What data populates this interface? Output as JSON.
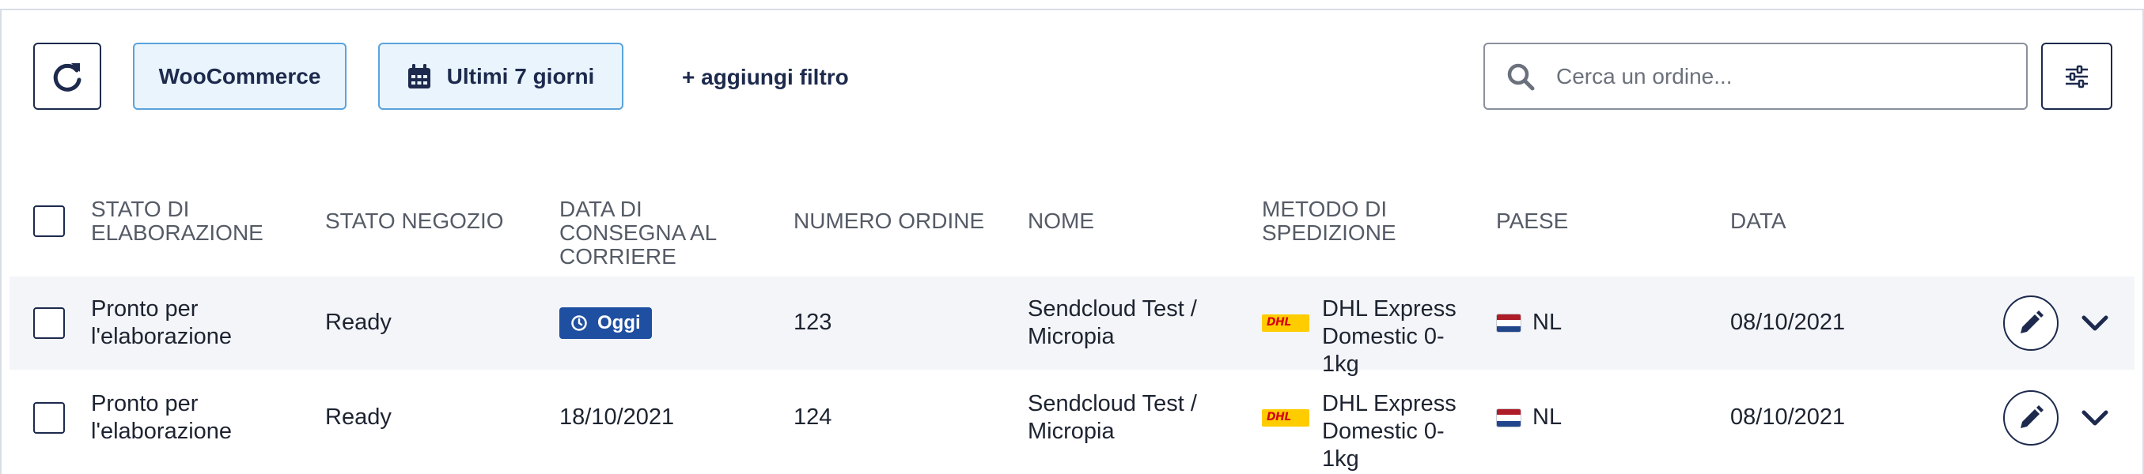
{
  "toolbar": {
    "woocommerce_label": "WooCommerce",
    "date_filter_label": "Ultimi 7 giorni",
    "add_filter_label": "+ aggiungi filtro",
    "search_placeholder": "Cerca un ordine..."
  },
  "table": {
    "headers": {
      "processing_status": "STATO DI ELABORAZIONE",
      "shop_status": "STATO NEGOZIO",
      "carrier_delivery_date": "DATA DI CONSEGNA AL CORRIERE",
      "order_number": "NUMERO ORDINE",
      "name": "NOME",
      "shipping_method": "METODO DI SPEDIZIONE",
      "country": "PAESE",
      "date": "DATA"
    },
    "rows": [
      {
        "processing_status": "Pronto per l'elaborazione",
        "shop_status": "Ready",
        "carrier_delivery_date": "Oggi",
        "carrier_delivery_is_badge": true,
        "order_number": "123",
        "name": "Sendcloud Test / Micropia",
        "carrier_logo_text": "DHL",
        "shipping_method": "DHL Express Domestic 0-1kg",
        "country": "NL",
        "date": "08/10/2021"
      },
      {
        "processing_status": "Pronto per l'elaborazione",
        "shop_status": "Ready",
        "carrier_delivery_date": "18/10/2021",
        "carrier_delivery_is_badge": false,
        "order_number": "124",
        "name": "Sendcloud Test / Micropia",
        "carrier_logo_text": "DHL",
        "shipping_method": "DHL Express Domestic 0-1kg",
        "country": "NL",
        "date": "08/10/2021"
      }
    ]
  },
  "colors": {
    "navy": "#1d2a4d",
    "chip_bg": "#e9f4fd",
    "chip_border": "#5aa3dc",
    "badge_bg": "#1e4fa0",
    "row_shade": "#f3f5f8",
    "dhl_yellow": "#ffcc00",
    "dhl_red": "#d40511",
    "flag_nl": [
      "#ae1c28",
      "#ffffff",
      "#21468b"
    ]
  },
  "icons": {
    "refresh": "refresh-icon",
    "calendar": "calendar-icon",
    "search": "search-icon",
    "settings": "sliders-icon",
    "clock": "clock-icon",
    "edit": "pencil-icon",
    "expand": "chevron-down-icon"
  }
}
